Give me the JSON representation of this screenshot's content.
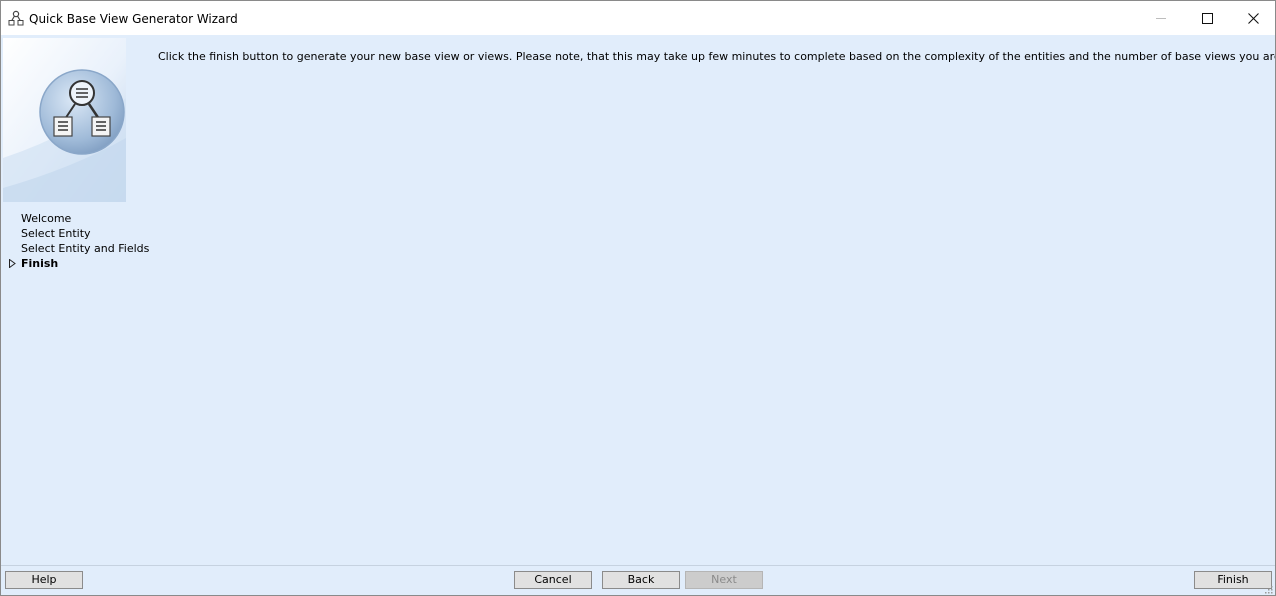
{
  "window": {
    "title": "Quick Base View Generator Wizard"
  },
  "icons": {
    "app": "view-generator-icon",
    "minimize": "minimize-icon",
    "maximize": "maximize-icon",
    "close": "close-icon",
    "wizard_image": "magnifier-documents-icon",
    "current_step": "triangle-right-icon"
  },
  "steps": [
    {
      "label": "Welcome",
      "current": false
    },
    {
      "label": "Select Entity",
      "current": false
    },
    {
      "label": "Select Entity and Fields",
      "current": false
    },
    {
      "label": "Finish",
      "current": true
    }
  ],
  "instruction": "Click the finish button to generate your new base view or views.  Please note, that this may take up few minutes to complete based on the complexity of the entities and the number of base views you are generating.",
  "buttons": {
    "help": "Help",
    "cancel": "Cancel",
    "back": "Back",
    "next": "Next",
    "finish": "Finish"
  },
  "colors": {
    "content_background": "#e1edfb",
    "button_face": "#e1e1e1",
    "disabled_button": "#cccccc"
  }
}
